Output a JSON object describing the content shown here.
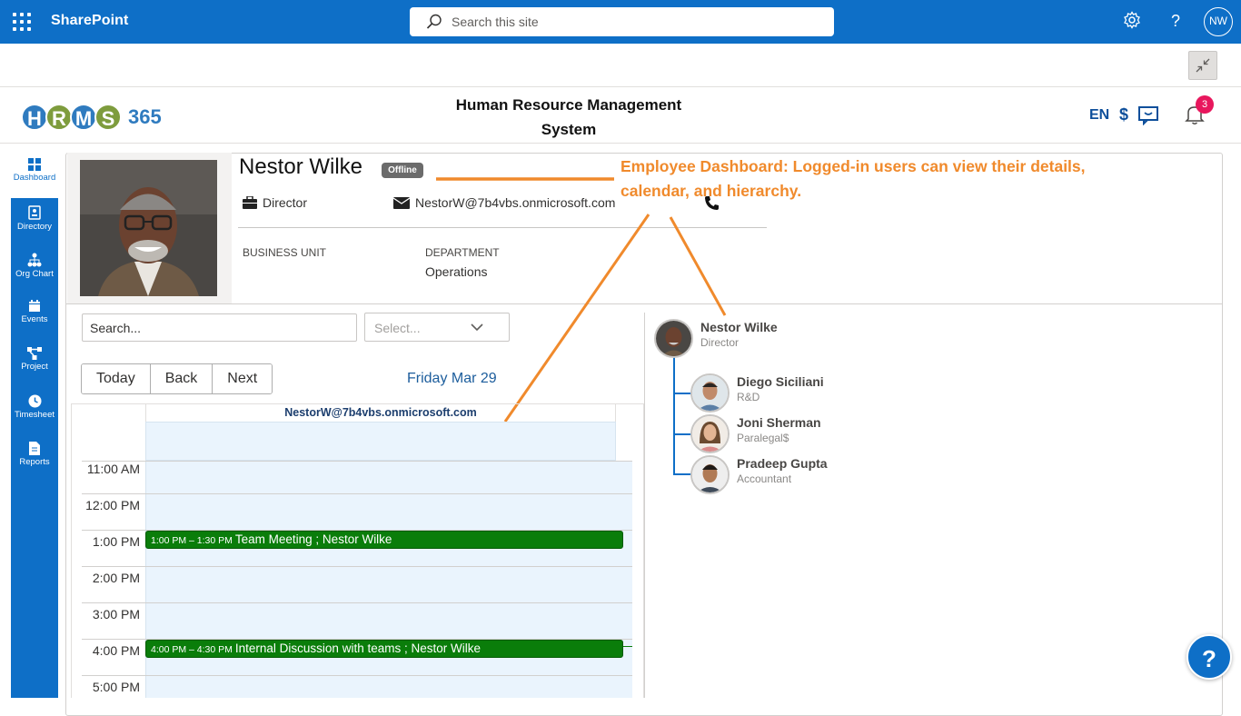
{
  "suite": {
    "app_name": "SharePoint",
    "search_placeholder": "Search this site",
    "user_initials": "NW"
  },
  "header": {
    "title_line1": "Human Resource Management",
    "title_line2": "System",
    "logo_letters": [
      "H",
      "R",
      "M",
      "S"
    ],
    "logo_number": "365",
    "language": "EN",
    "currency": "$",
    "notification_count": "3"
  },
  "nav": {
    "items": [
      {
        "label": "Dashboard",
        "icon": "grid-icon",
        "active": true
      },
      {
        "label": "Directory",
        "icon": "contact-card-icon"
      },
      {
        "label": "Org Chart",
        "icon": "hierarchy-icon"
      },
      {
        "label": "Events",
        "icon": "calendar-icon"
      },
      {
        "label": "Project",
        "icon": "project-nodes-icon"
      },
      {
        "label": "Timesheet",
        "icon": "clock-icon"
      },
      {
        "label": "Reports",
        "icon": "document-icon"
      }
    ]
  },
  "profile": {
    "name": "Nestor Wilke",
    "status": "Offline",
    "title": "Director",
    "email": "NestorW@7b4vbs.onmicrosoft.com",
    "business_unit_label": "BUSINESS UNIT",
    "business_unit_value": "",
    "department_label": "DEPARTMENT",
    "department_value": "Operations"
  },
  "annotation": {
    "line1": "Employee Dashboard: Logged-in users can view their details,",
    "line2": "calendar, and hierarchy.",
    "color": "#f08a2c"
  },
  "calendar": {
    "search_placeholder": "Search...",
    "select_placeholder": "Select...",
    "buttons": {
      "today": "Today",
      "back": "Back",
      "next": "Next"
    },
    "date_label": "Friday Mar 29",
    "resource": "NestorW@7b4vbs.onmicrosoft.com",
    "times": [
      "11:00 AM",
      "12:00 PM",
      "1:00 PM",
      "2:00 PM",
      "3:00 PM",
      "4:00 PM",
      "5:00 PM"
    ],
    "events": [
      {
        "time": "1:00 PM – 1:30 PM",
        "title": "Team Meeting ; Nestor Wilke",
        "color": "#0a7d0a"
      },
      {
        "time": "4:00 PM – 4:30 PM",
        "title": "Internal Discussion with teams ; Nestor Wilke",
        "color": "#0a7d0a"
      }
    ]
  },
  "org_chart": {
    "manager": {
      "name": "Nestor Wilke",
      "role": "Director"
    },
    "reports": [
      {
        "name": "Diego Siciliani",
        "role": "R&D"
      },
      {
        "name": "Joni Sherman",
        "role": "Paralegal$"
      },
      {
        "name": "Pradeep Gupta",
        "role": "Accountant"
      }
    ]
  },
  "help": {
    "label": "?"
  },
  "colors": {
    "brand": "#0e6fc7",
    "event": "#0a7d0a",
    "badge": "#e8175d"
  }
}
